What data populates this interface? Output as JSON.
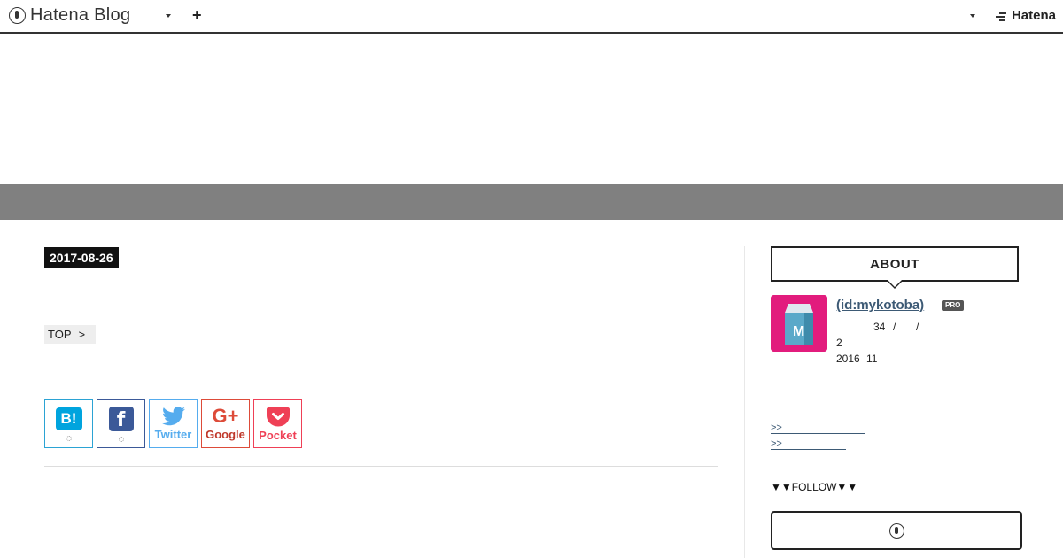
{
  "topbar": {
    "logo_text": "Hatena Blog",
    "add_label": "+",
    "brand_text": "Hatena"
  },
  "entry": {
    "date": "2017-08-26",
    "breadcrumb_top": "TOP",
    "breadcrumb_sep": ">"
  },
  "share": {
    "hatena_label": "B!",
    "facebook_label": "f",
    "twitter_label": "Twitter",
    "google_label": "Google",
    "google_mark": "G+",
    "pocket_label": "Pocket"
  },
  "sidebar": {
    "about_title": "ABOUT",
    "profile_name": " (id:mykotoba)",
    "pro_badge": "PRO",
    "avatar_letter": "M",
    "line1_num": "34",
    "line1_sep1": "/",
    "line1_sep2": "/",
    "line2": "2",
    "line3_year": "2016",
    "line3_month": "11",
    "link1": ">>",
    "link2": ">>",
    "follow_heading": "▼▼FOLLOW▼▼"
  },
  "colors": {
    "header_band": "#808080",
    "avatar_bg": "#e21c7d",
    "hatena_blue": "#00a4de",
    "facebook": "#3b5998",
    "twitter": "#55acee",
    "google": "#dd4b39",
    "pocket": "#ef4056"
  }
}
